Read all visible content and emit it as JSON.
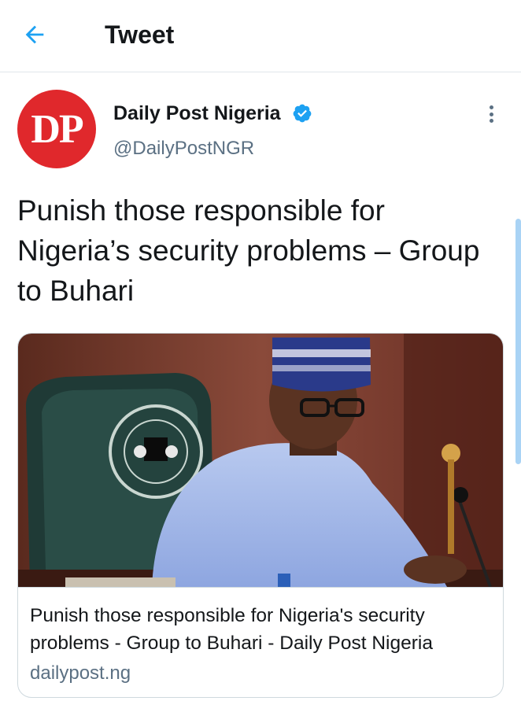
{
  "header": {
    "title": "Tweet",
    "back_icon": "arrow-left-icon",
    "accent_color": "#1da1f2"
  },
  "tweet": {
    "author": {
      "avatar_text": "DP",
      "avatar_color": "#e0282c",
      "name": "Daily Post Nigeria",
      "handle": "@DailyPostNGR",
      "verified": true
    },
    "more_icon": "more-vertical-icon",
    "text": "Punish those responsible for Nigeria’s security problems – Group to Buhari",
    "card": {
      "image_alt_icon": "photo-icon",
      "title": "Punish those responsible for Nigeria's security problems - Group to Buhari - Daily Post Nigeria",
      "domain": "dailypost.ng"
    }
  }
}
